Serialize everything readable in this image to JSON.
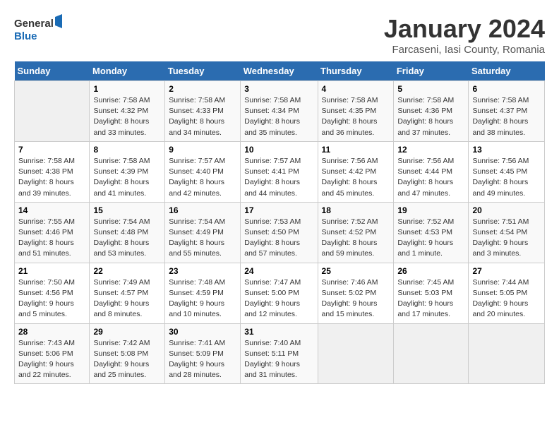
{
  "header": {
    "logo_line1": "General",
    "logo_line2": "Blue",
    "month_title": "January 2024",
    "subtitle": "Farcaseni, Iasi County, Romania"
  },
  "weekdays": [
    "Sunday",
    "Monday",
    "Tuesday",
    "Wednesday",
    "Thursday",
    "Friday",
    "Saturday"
  ],
  "weeks": [
    [
      {
        "day": "",
        "info": ""
      },
      {
        "day": "1",
        "info": "Sunrise: 7:58 AM\nSunset: 4:32 PM\nDaylight: 8 hours\nand 33 minutes."
      },
      {
        "day": "2",
        "info": "Sunrise: 7:58 AM\nSunset: 4:33 PM\nDaylight: 8 hours\nand 34 minutes."
      },
      {
        "day": "3",
        "info": "Sunrise: 7:58 AM\nSunset: 4:34 PM\nDaylight: 8 hours\nand 35 minutes."
      },
      {
        "day": "4",
        "info": "Sunrise: 7:58 AM\nSunset: 4:35 PM\nDaylight: 8 hours\nand 36 minutes."
      },
      {
        "day": "5",
        "info": "Sunrise: 7:58 AM\nSunset: 4:36 PM\nDaylight: 8 hours\nand 37 minutes."
      },
      {
        "day": "6",
        "info": "Sunrise: 7:58 AM\nSunset: 4:37 PM\nDaylight: 8 hours\nand 38 minutes."
      }
    ],
    [
      {
        "day": "7",
        "info": "Sunrise: 7:58 AM\nSunset: 4:38 PM\nDaylight: 8 hours\nand 39 minutes."
      },
      {
        "day": "8",
        "info": "Sunrise: 7:58 AM\nSunset: 4:39 PM\nDaylight: 8 hours\nand 41 minutes."
      },
      {
        "day": "9",
        "info": "Sunrise: 7:57 AM\nSunset: 4:40 PM\nDaylight: 8 hours\nand 42 minutes."
      },
      {
        "day": "10",
        "info": "Sunrise: 7:57 AM\nSunset: 4:41 PM\nDaylight: 8 hours\nand 44 minutes."
      },
      {
        "day": "11",
        "info": "Sunrise: 7:56 AM\nSunset: 4:42 PM\nDaylight: 8 hours\nand 45 minutes."
      },
      {
        "day": "12",
        "info": "Sunrise: 7:56 AM\nSunset: 4:44 PM\nDaylight: 8 hours\nand 47 minutes."
      },
      {
        "day": "13",
        "info": "Sunrise: 7:56 AM\nSunset: 4:45 PM\nDaylight: 8 hours\nand 49 minutes."
      }
    ],
    [
      {
        "day": "14",
        "info": "Sunrise: 7:55 AM\nSunset: 4:46 PM\nDaylight: 8 hours\nand 51 minutes."
      },
      {
        "day": "15",
        "info": "Sunrise: 7:54 AM\nSunset: 4:48 PM\nDaylight: 8 hours\nand 53 minutes."
      },
      {
        "day": "16",
        "info": "Sunrise: 7:54 AM\nSunset: 4:49 PM\nDaylight: 8 hours\nand 55 minutes."
      },
      {
        "day": "17",
        "info": "Sunrise: 7:53 AM\nSunset: 4:50 PM\nDaylight: 8 hours\nand 57 minutes."
      },
      {
        "day": "18",
        "info": "Sunrise: 7:52 AM\nSunset: 4:52 PM\nDaylight: 8 hours\nand 59 minutes."
      },
      {
        "day": "19",
        "info": "Sunrise: 7:52 AM\nSunset: 4:53 PM\nDaylight: 9 hours\nand 1 minute."
      },
      {
        "day": "20",
        "info": "Sunrise: 7:51 AM\nSunset: 4:54 PM\nDaylight: 9 hours\nand 3 minutes."
      }
    ],
    [
      {
        "day": "21",
        "info": "Sunrise: 7:50 AM\nSunset: 4:56 PM\nDaylight: 9 hours\nand 5 minutes."
      },
      {
        "day": "22",
        "info": "Sunrise: 7:49 AM\nSunset: 4:57 PM\nDaylight: 9 hours\nand 8 minutes."
      },
      {
        "day": "23",
        "info": "Sunrise: 7:48 AM\nSunset: 4:59 PM\nDaylight: 9 hours\nand 10 minutes."
      },
      {
        "day": "24",
        "info": "Sunrise: 7:47 AM\nSunset: 5:00 PM\nDaylight: 9 hours\nand 12 minutes."
      },
      {
        "day": "25",
        "info": "Sunrise: 7:46 AM\nSunset: 5:02 PM\nDaylight: 9 hours\nand 15 minutes."
      },
      {
        "day": "26",
        "info": "Sunrise: 7:45 AM\nSunset: 5:03 PM\nDaylight: 9 hours\nand 17 minutes."
      },
      {
        "day": "27",
        "info": "Sunrise: 7:44 AM\nSunset: 5:05 PM\nDaylight: 9 hours\nand 20 minutes."
      }
    ],
    [
      {
        "day": "28",
        "info": "Sunrise: 7:43 AM\nSunset: 5:06 PM\nDaylight: 9 hours\nand 22 minutes."
      },
      {
        "day": "29",
        "info": "Sunrise: 7:42 AM\nSunset: 5:08 PM\nDaylight: 9 hours\nand 25 minutes."
      },
      {
        "day": "30",
        "info": "Sunrise: 7:41 AM\nSunset: 5:09 PM\nDaylight: 9 hours\nand 28 minutes."
      },
      {
        "day": "31",
        "info": "Sunrise: 7:40 AM\nSunset: 5:11 PM\nDaylight: 9 hours\nand 31 minutes."
      },
      {
        "day": "",
        "info": ""
      },
      {
        "day": "",
        "info": ""
      },
      {
        "day": "",
        "info": ""
      }
    ]
  ]
}
